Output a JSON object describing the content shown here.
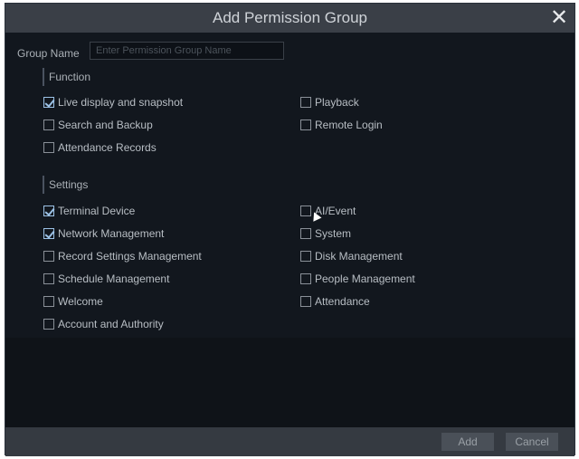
{
  "dialog": {
    "title": "Add Permission Group",
    "close_glyph": "✕"
  },
  "group_name": {
    "label": "Group Name",
    "placeholder": "Enter Permission Group Name",
    "value": ""
  },
  "function": {
    "title": "Function",
    "items": [
      {
        "label": "Live display and snapshot",
        "checked": true
      },
      {
        "label": "Playback",
        "checked": false
      },
      {
        "label": "Search and Backup",
        "checked": false
      },
      {
        "label": "Remote Login",
        "checked": false
      },
      {
        "label": "Attendance Records",
        "checked": false
      }
    ]
  },
  "settings": {
    "title": "Settings",
    "items": [
      {
        "label": "Terminal Device",
        "checked": true
      },
      {
        "label": "AI/Event",
        "checked": false
      },
      {
        "label": "Network Management",
        "checked": true
      },
      {
        "label": "System",
        "checked": false
      },
      {
        "label": "Record Settings Management",
        "checked": false
      },
      {
        "label": "Disk Management",
        "checked": false
      },
      {
        "label": "Schedule Management",
        "checked": false
      },
      {
        "label": "People Management",
        "checked": false
      },
      {
        "label": "Welcome",
        "checked": false
      },
      {
        "label": "Attendance",
        "checked": false
      },
      {
        "label": "Account and Authority",
        "checked": false
      }
    ]
  },
  "footer": {
    "add_label": "Add",
    "cancel_label": "Cancel"
  },
  "colors": {
    "check_accent": "#9cc2e6",
    "title_bar": "#3a3f47",
    "panel_bg": "#12171e"
  }
}
